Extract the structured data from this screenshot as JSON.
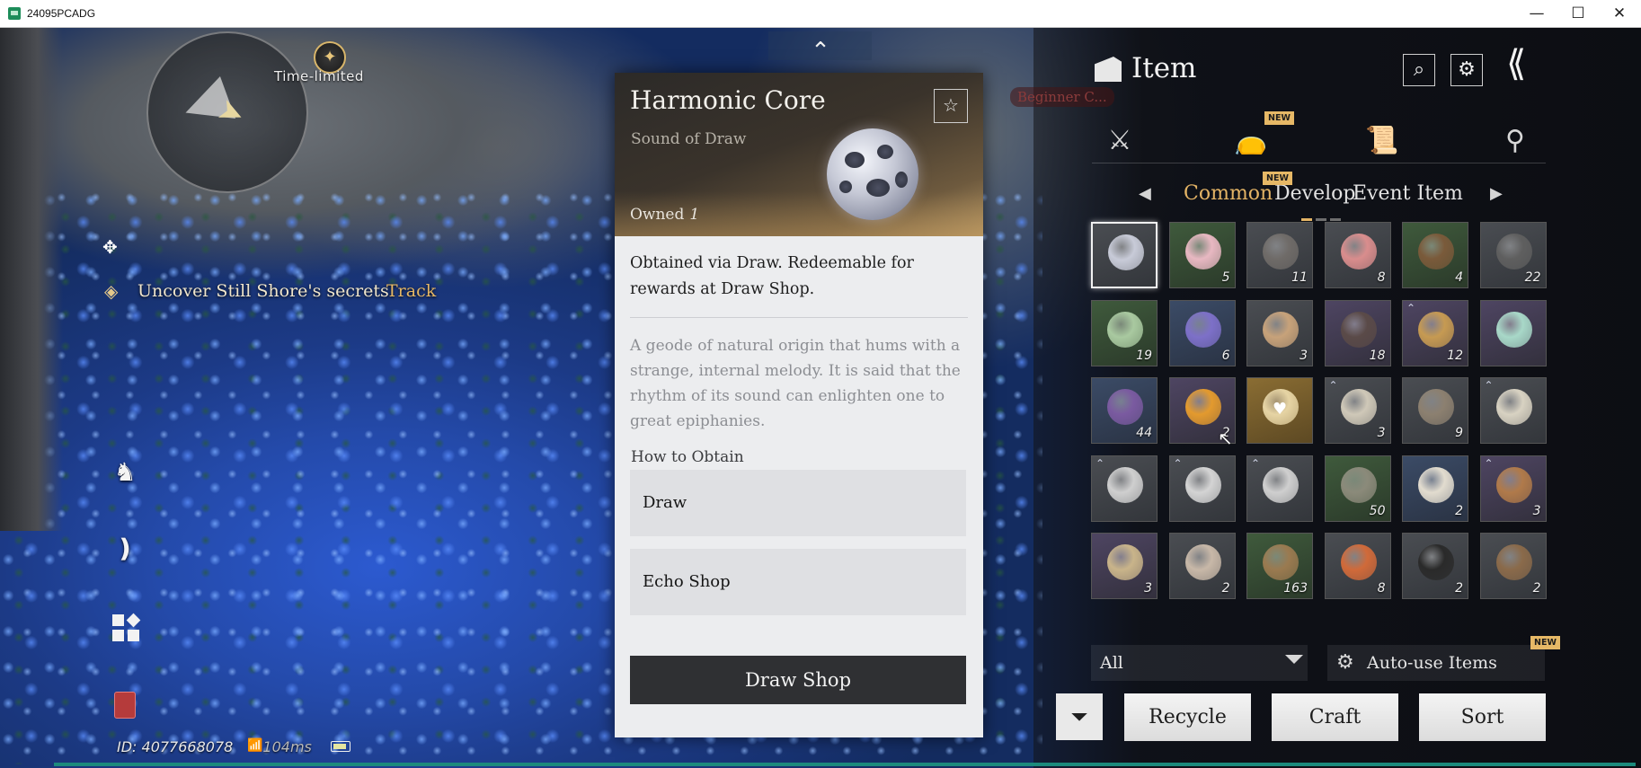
{
  "window": {
    "title": "24095PCADG",
    "min_glyph": "—",
    "max_glyph": "☐",
    "close_glyph": "✕"
  },
  "hud": {
    "time_limited_label": "Time-limited",
    "quest_text": "Uncover Still Shore's secrets",
    "quest_track": "Track",
    "uid": "ID: 4077668078",
    "ping": "104ms"
  },
  "detail": {
    "name": "Harmonic Core",
    "subtitle": "Sound of Draw",
    "owned_label": "Owned",
    "owned_count": "1",
    "obtained_text": "Obtained via Draw. Redeemable for rewards at Draw Shop.",
    "lore_text": "A geode of natural origin that hums with a strange, internal melody. It is said that the rhythm of its sound can enlighten one to great epiphanies.",
    "how_to_obtain_label": "How to Obtain",
    "sources": [
      "Draw",
      "Echo Shop"
    ],
    "draw_shop_label": "Draw Shop"
  },
  "inventory": {
    "title": "Item",
    "beginner_tag": "Beginner C...",
    "new_badge": "NEW",
    "category_tabs": [
      {
        "name": "equipment",
        "glyph": "⚔"
      },
      {
        "name": "bag",
        "glyph": "👝"
      },
      {
        "name": "scroll",
        "glyph": "📜"
      },
      {
        "name": "location",
        "glyph": "⚲"
      }
    ],
    "sub_tabs": [
      "Common",
      "Develop",
      "Event Item"
    ],
    "active_sub_tab": "Common",
    "page_count": 3,
    "active_page": 1,
    "items": [
      {
        "qty": "",
        "quality": "grey",
        "color": "#c8cbd8",
        "selected": true
      },
      {
        "qty": "5",
        "quality": "green",
        "color": "#e8b8c2"
      },
      {
        "qty": "11",
        "quality": "grey",
        "color": "#6f6b68"
      },
      {
        "qty": "8",
        "quality": "grey",
        "color": "#d98d8d"
      },
      {
        "qty": "4",
        "quality": "green",
        "color": "#7a5a3a"
      },
      {
        "qty": "22",
        "quality": "grey",
        "color": "#5f5f5f"
      },
      {
        "qty": "19",
        "quality": "green",
        "color": "#a9c9a0"
      },
      {
        "qty": "6",
        "quality": "blue",
        "color": "#7d70c8"
      },
      {
        "qty": "3",
        "quality": "grey",
        "color": "#c7a27a"
      },
      {
        "qty": "18",
        "quality": "purple",
        "color": "#5a4a48"
      },
      {
        "qty": "12",
        "quality": "purple",
        "color": "#c69a52",
        "up": true
      },
      {
        "qty": "",
        "quality": "purple",
        "color": "#a8d8c8"
      },
      {
        "qty": "44",
        "quality": "blue",
        "color": "#7a5aa0"
      },
      {
        "qty": "2",
        "quality": "purple",
        "color": "#e39a2e"
      },
      {
        "qty": "",
        "quality": "gold",
        "color": "#e6d4a4",
        "heart": true
      },
      {
        "qty": "3",
        "quality": "grey",
        "color": "#cfc8b8",
        "up": true
      },
      {
        "qty": "9",
        "quality": "grey",
        "color": "#8c8070"
      },
      {
        "qty": "",
        "quality": "grey",
        "color": "#d8d2c2",
        "up": true
      },
      {
        "qty": "",
        "quality": "grey",
        "color": "#cfcfcf",
        "up": true
      },
      {
        "qty": "",
        "quality": "grey",
        "color": "#d4d4d4",
        "up": true
      },
      {
        "qty": "",
        "quality": "grey",
        "color": "#cfcfcf",
        "up": true
      },
      {
        "qty": "50",
        "quality": "green",
        "color": "#8b8a7a"
      },
      {
        "qty": "2",
        "quality": "blue",
        "color": "#e2dccf"
      },
      {
        "qty": "3",
        "quality": "purple",
        "color": "#b07a4a",
        "up": true
      },
      {
        "qty": "3",
        "quality": "purple",
        "color": "#c9b48a"
      },
      {
        "qty": "2",
        "quality": "grey",
        "color": "#c8b8a8"
      },
      {
        "qty": "163",
        "quality": "green",
        "color": "#9a7a50"
      },
      {
        "qty": "8",
        "quality": "grey",
        "color": "#d06a3a"
      },
      {
        "qty": "2",
        "quality": "grey",
        "color": "#2a2a2a"
      },
      {
        "qty": "2",
        "quality": "grey",
        "color": "#8a6a4a"
      }
    ],
    "filter_value": "All",
    "auto_use_label": "Auto-use Items",
    "recycle_label": "Recycle",
    "craft_label": "Craft",
    "sort_label": "Sort"
  }
}
